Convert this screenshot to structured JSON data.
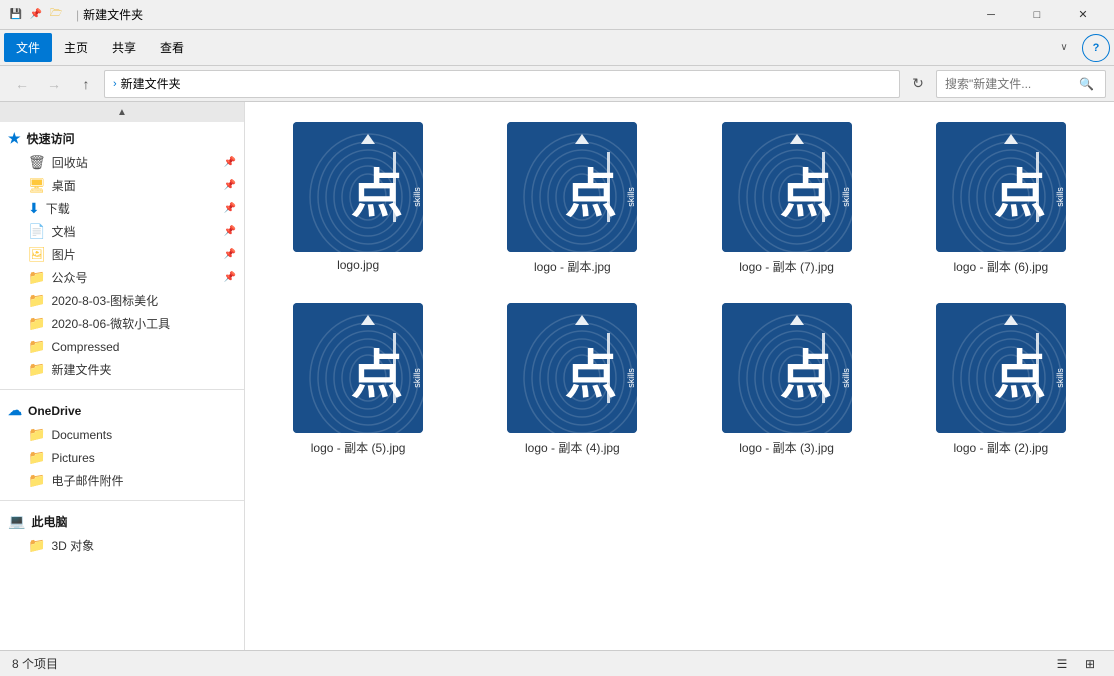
{
  "titleBar": {
    "title": "新建文件夹",
    "minimizeLabel": "─",
    "maximizeLabel": "□",
    "closeLabel": "✕"
  },
  "menuBar": {
    "items": [
      {
        "id": "file",
        "label": "文件",
        "active": true
      },
      {
        "id": "home",
        "label": "主页",
        "active": false
      },
      {
        "id": "share",
        "label": "共享",
        "active": false
      },
      {
        "id": "view",
        "label": "查看",
        "active": false
      }
    ]
  },
  "addressBar": {
    "path": "新建文件夹",
    "searchPlaceholder": "搜索\"新建文件...",
    "refreshTitle": "刷新"
  },
  "sidebar": {
    "quickAccessLabel": "快速访问",
    "items": [
      {
        "id": "recycle",
        "label": "回收站",
        "icon": "recycle",
        "pinned": true
      },
      {
        "id": "desktop",
        "label": "桌面",
        "icon": "desktop",
        "pinned": true
      },
      {
        "id": "downloads",
        "label": "下载",
        "icon": "download",
        "pinned": true
      },
      {
        "id": "documents",
        "label": "文档",
        "icon": "document",
        "pinned": true
      },
      {
        "id": "pictures",
        "label": "图片",
        "icon": "picture",
        "pinned": true
      },
      {
        "id": "gongzhonghao",
        "label": "公众号",
        "icon": "purple-folder",
        "pinned": true
      },
      {
        "id": "folder1",
        "label": "2020-8-03-图标美化",
        "icon": "folder",
        "pinned": false
      },
      {
        "id": "folder2",
        "label": "2020-8-06-微软小工具",
        "icon": "folder",
        "pinned": false
      },
      {
        "id": "compressed",
        "label": "Compressed",
        "icon": "folder",
        "pinned": false
      },
      {
        "id": "newfolder",
        "label": "新建文件夹",
        "icon": "folder",
        "pinned": false
      }
    ],
    "oneDriveLabel": "OneDrive",
    "oneDriveItems": [
      {
        "id": "od-documents",
        "label": "Documents",
        "icon": "folder"
      },
      {
        "id": "od-pictures",
        "label": "Pictures",
        "icon": "folder"
      },
      {
        "id": "od-attachments",
        "label": "电子邮件附件",
        "icon": "folder"
      }
    ],
    "thisPC": "此电脑",
    "thisPCItems": [
      {
        "id": "3d",
        "label": "3D 对象",
        "icon": "folder"
      }
    ]
  },
  "files": [
    {
      "id": "logo1",
      "name": "logo.jpg"
    },
    {
      "id": "logo2",
      "name": "logo - 副本.jpg"
    },
    {
      "id": "logo3",
      "name": "logo - 副本 (7).jpg"
    },
    {
      "id": "logo4",
      "name": "logo - 副本 (6).jpg"
    },
    {
      "id": "logo5",
      "name": "logo - 副本 (5).jpg"
    },
    {
      "id": "logo6",
      "name": "logo - 副本 (4).jpg"
    },
    {
      "id": "logo7",
      "name": "logo - 副本 (3).jpg"
    },
    {
      "id": "logo8",
      "name": "logo - 副本 (2).jpg"
    }
  ],
  "statusBar": {
    "itemCount": "8 个项目"
  }
}
